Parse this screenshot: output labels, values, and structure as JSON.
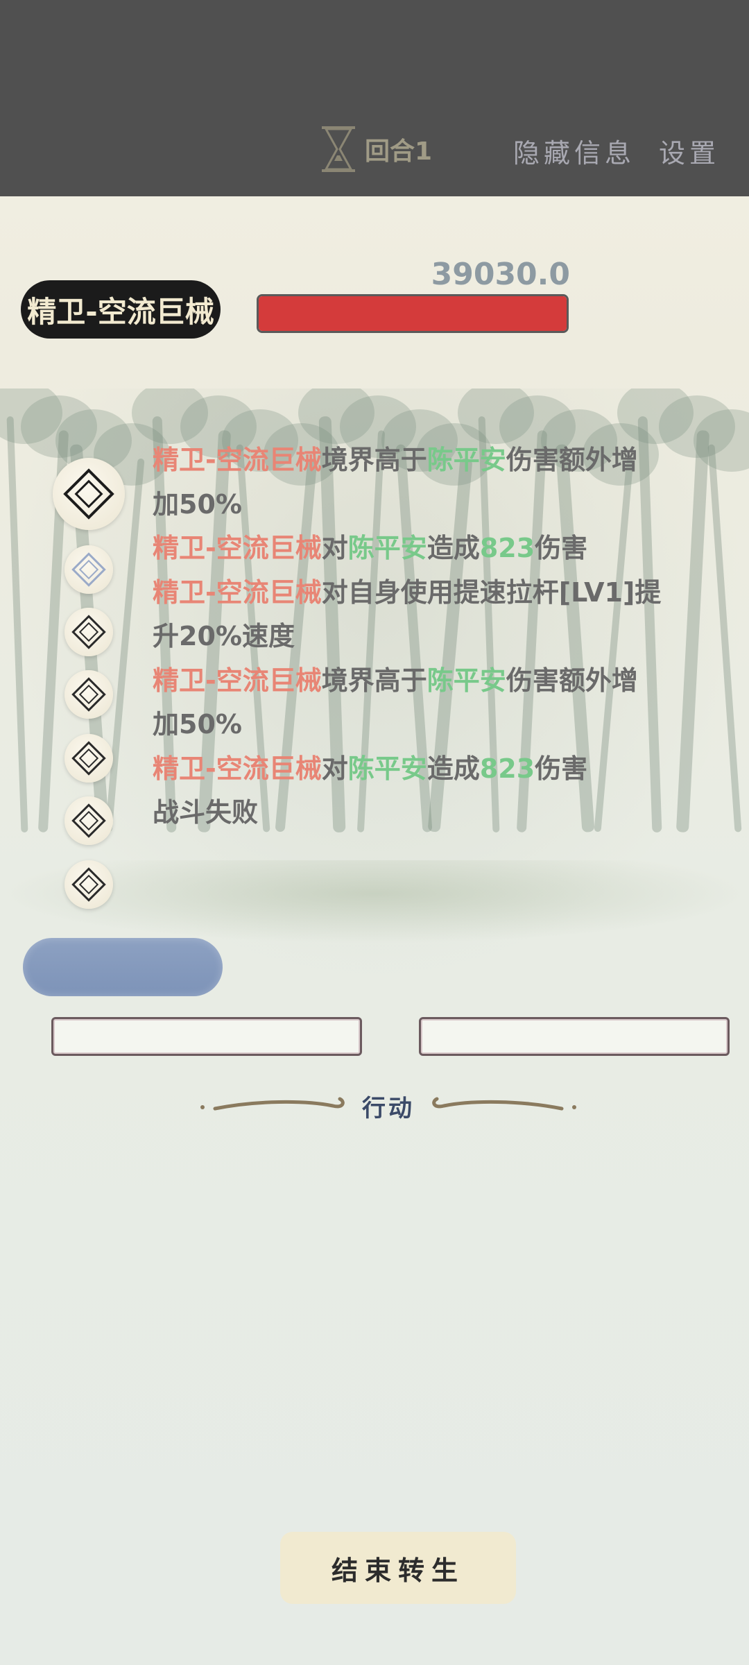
{
  "topbar": {
    "round_label": "回合1",
    "hide_info_label": "隐藏信息",
    "settings_label": "设置"
  },
  "boss": {
    "name": "精卫-空流巨械",
    "hp_text": "39030.0",
    "hp_fraction": 1.0
  },
  "battle_log": [
    [
      {
        "t": "精卫-空流巨械",
        "c": "red"
      },
      {
        "t": "境界高于",
        "c": "gray"
      },
      {
        "t": "陈平安",
        "c": "green"
      },
      {
        "t": "伤害额外增",
        "c": "gray"
      }
    ],
    [
      {
        "t": "加50%",
        "c": "gray"
      }
    ],
    [
      {
        "t": "精卫-空流巨械",
        "c": "red"
      },
      {
        "t": "对",
        "c": "gray"
      },
      {
        "t": "陈平安",
        "c": "green"
      },
      {
        "t": "造成",
        "c": "gray"
      },
      {
        "t": "823",
        "c": "green"
      },
      {
        "t": "伤害",
        "c": "gray"
      }
    ],
    [
      {
        "t": "精卫-空流巨械",
        "c": "red"
      },
      {
        "t": "对自身使用提速拉杆[LV1]提",
        "c": "gray"
      }
    ],
    [
      {
        "t": "升20%速度",
        "c": "gray"
      }
    ],
    [
      {
        "t": "精卫-空流巨械",
        "c": "red"
      },
      {
        "t": "境界高于",
        "c": "gray"
      },
      {
        "t": "陈平安",
        "c": "green"
      },
      {
        "t": "伤害额外增",
        "c": "gray"
      }
    ],
    [
      {
        "t": "加50%",
        "c": "gray"
      }
    ],
    [
      {
        "t": "精卫-空流巨械",
        "c": "red"
      },
      {
        "t": "对",
        "c": "gray"
      },
      {
        "t": "陈平安",
        "c": "green"
      },
      {
        "t": "造成",
        "c": "gray"
      },
      {
        "t": "823",
        "c": "green"
      },
      {
        "t": "伤害",
        "c": "gray"
      }
    ],
    [
      {
        "t": "战斗失败",
        "c": "gray"
      }
    ]
  ],
  "action": {
    "label": "行动"
  },
  "end_button_label": "结束转生",
  "colors": {
    "topbar": "#505050",
    "hp_fill": "#d43b3b",
    "enemy_text": "#e88575",
    "player_text": "#78c98a",
    "log_text": "#6a6a6a",
    "skill_pill": "#8da1c2"
  },
  "icons": [
    "hourglass-icon",
    "diamond-node-icon"
  ]
}
